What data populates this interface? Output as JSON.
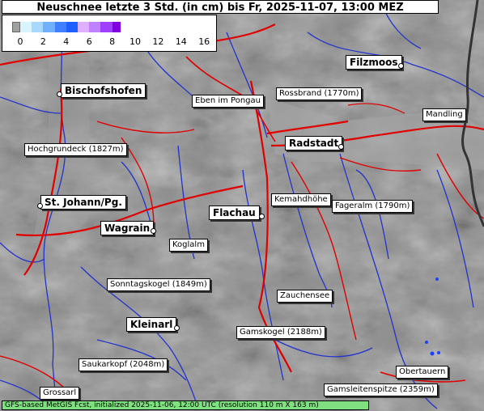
{
  "title": "Neuschnee letzte 3 Std. (in cm) bis Fr, 2025-11-07, 13:00 MEZ",
  "legend": {
    "ticks": [
      "0",
      "2",
      "4",
      "6",
      "8",
      "10",
      "12",
      "14",
      "16"
    ],
    "colors": [
      "#a0a0a0",
      "#d8f4ff",
      "#a8d8ff",
      "#70b0ff",
      "#4080ff",
      "#1e60ff",
      "#e0b0ff",
      "#c080ff",
      "#a040ff",
      "#8000e0"
    ]
  },
  "towns": {
    "bischofshofen": "Bischofshofen",
    "st_johann": "St. Johann/Pg.",
    "wagrain": "Wagrain",
    "flachau": "Flachau",
    "radstadt": "Radstadt",
    "filzmoos": "Filzmoos",
    "kleinarl": "Kleinarl"
  },
  "places": {
    "eben": "Eben im Pongau",
    "rossbrand": "Rossbrand (1770m)",
    "mandling": "Mandling",
    "hochgrundeck": "Hochgrundeck (1827m)",
    "kemahdhoehe": "Kemahdhöhe",
    "fageralm": "Fageralm (1790m)",
    "koglalm": "Koglalm",
    "sonntagskogel": "Sonntagskogel (1849m)",
    "zauchensee": "Zauchensee",
    "gamskogel": "Gamskogel (2188m)",
    "saukarkopf": "Saukarkopf (2048m)",
    "obertauern": "Obertauern",
    "grossarl": "Grossarl",
    "gamsleitenspitze": "Gamsleitenspitze (2359m)"
  },
  "footer": "GFS-based MetGIS Fcst, initialized 2025-11-06, 12:00 UTC  (resolution 110 m X 163 m)",
  "colors": {
    "road": "#e00000",
    "river": "#2233cc",
    "border": "#333333",
    "terrain": "#8a8a8a"
  }
}
